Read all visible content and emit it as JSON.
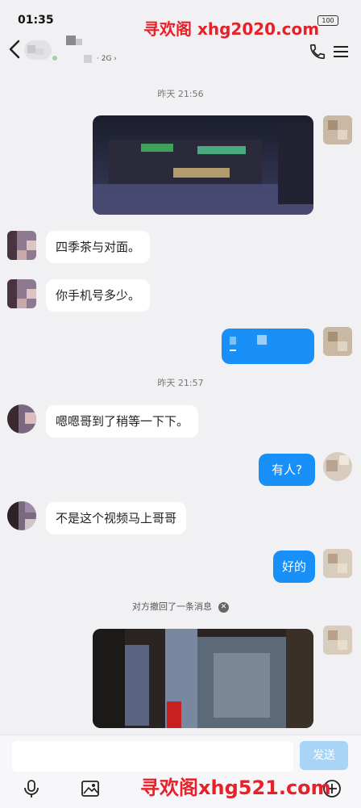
{
  "status_bar": {
    "time": "01:35",
    "battery": "100"
  },
  "watermark": {
    "top": "寻欢阁 xhg2020.com",
    "bottom": "寻欢阁xhg521.com"
  },
  "header": {
    "subtitle": "· 2G ›"
  },
  "messages": {
    "ts1": "昨天 21:56",
    "m_left_1": "四季茶与对面。",
    "m_left_2": "你手机号多少。",
    "ts2": "昨天 21:57",
    "m_left_3": "嗯嗯哥到了稍等一下下。",
    "m_right_1": "有人?",
    "m_left_4": "不是这个视频马上哥哥",
    "m_right_2": "好的",
    "recall": "对方撤回了一条消息"
  },
  "input": {
    "placeholder": "",
    "send_label": "发送"
  },
  "icons": [
    "back-icon",
    "phone-icon",
    "menu-icon",
    "mic-icon",
    "image-icon",
    "add-icon"
  ],
  "colors": {
    "accent": "#1890f8",
    "send_disabled": "#a8d4f8",
    "background": "#f1f1f4"
  }
}
